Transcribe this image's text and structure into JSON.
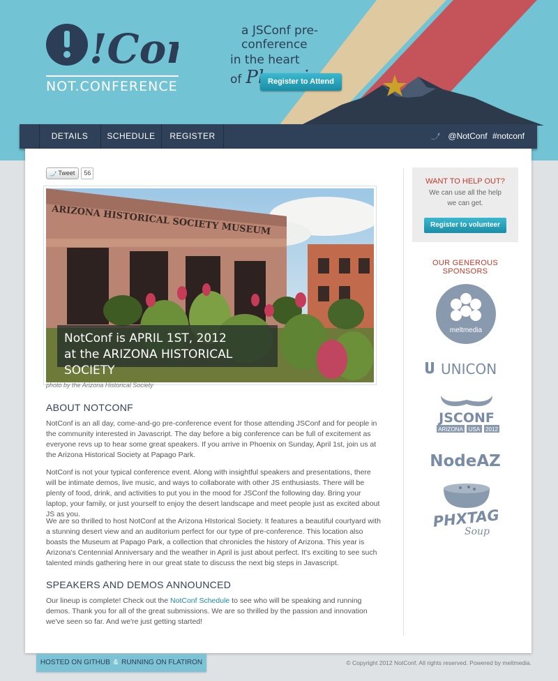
{
  "header": {
    "logo_text": "!Conf",
    "logo_subtitle": "NOT.CONFERENCE",
    "tagline_line1": "a JSConf pre-conference",
    "tagline_line2": "in the heart of",
    "tagline_city": "Phoenix",
    "register_label": "Register to Attend"
  },
  "nav": {
    "items": [
      "DETAILS",
      "SCHEDULE",
      "REGISTER"
    ],
    "twitter_handle": "@NotConf",
    "hashtag": "#notconf"
  },
  "tweet": {
    "label": "Tweet",
    "count": "56"
  },
  "hero": {
    "caption_line1": "NotConf is APRIL 1ST, 2012",
    "caption_line2": "at the ARIZONA HISTORICAL SOCIETY",
    "building_sign": "ARIZONA HISTORICAL SOCIETY MUSEUM",
    "photo_credit": "photo by the Arizona Historical Society"
  },
  "about": {
    "title": "ABOUT NOTCONF",
    "p1": "NotConf is an all day, come-and-go pre-conference event for those attending JSConf and for people in the community interested in Javascript. The day before a big conference can be full of excitement as everyone revs up to hear some great speakers. If you arrive in Phoenix on Sunday, April 1st, join us at the Arizona Historical Society at Papago Park.",
    "p2": "NotConf is not your typical conference event. Along with insightful speakers and presentations, there will be intimate demos, live music, and ways to collaborate with other JS enthusiasts. There will be plenty of food, drink, and activities to put you in the mood for JSConf the following day. Bring your laptop, your family, or just yourself to enjoy the desert landscape and meet people just as excited about JS as you.",
    "p3": "We are so thrilled to host NotConf at the Arizona HIstorical Society. It features a beautiful courtyard with a stunning desert view and an auditorium perfect for our type of pre-conference. This location also boasts the Museum at Papago Park, a collection that chronicles the history of Arizona. This year is Arizona's Centennial Anniversary and the weather in April is just about perfect. It's exciting to see such talented minds gathering here in our great state to discuss the next big steps in Javascript."
  },
  "speakers": {
    "title": "SPEAKERS AND DEMOS ANNOUNCED",
    "text_before": "Our lineup is complete! Check out the ",
    "link_label": "NotConf Schedule",
    "text_after": " to see who will be speaking and running demos. Thank you for all of the great submissions. We are so thrilled by the passion and innovation we've seen so far. And we're just getting started!"
  },
  "sidebar": {
    "help_title": "WANT TO HELP OUT?",
    "help_text": "We can use all the help we can get.",
    "volunteer_label": "Register to volunteer",
    "sponsors_title": "OUR GENEROUS SPONSORS",
    "sponsors": {
      "meltmedia": "meltmedia",
      "unicon": "UNICON",
      "jsconf": "JSCONF",
      "jsconf_sub1": "ARIZONA",
      "jsconf_sub2": "USA",
      "jsconf_sub3": "2012",
      "nodeaz": "NodeAZ",
      "phxtag": "PHXTAG",
      "phxtag_sub": "Soup"
    }
  },
  "footer": {
    "github_label": "HOSTED ON GITHUB",
    "separator": "&",
    "flatiron_label": "RUNNING ON FLATIRON",
    "copyright": "© Copyright 2012 NotConf. All rights reserved. Powered by meltmedia."
  },
  "colors": {
    "sky": "#72c3d4",
    "navy": "#2f4159",
    "accent_red": "#c0392b",
    "button_teal": "#1a8ea6",
    "stripe_cream": "#dfc9a0",
    "stripe_red": "#c4545a",
    "star_gold": "#c9a227"
  }
}
